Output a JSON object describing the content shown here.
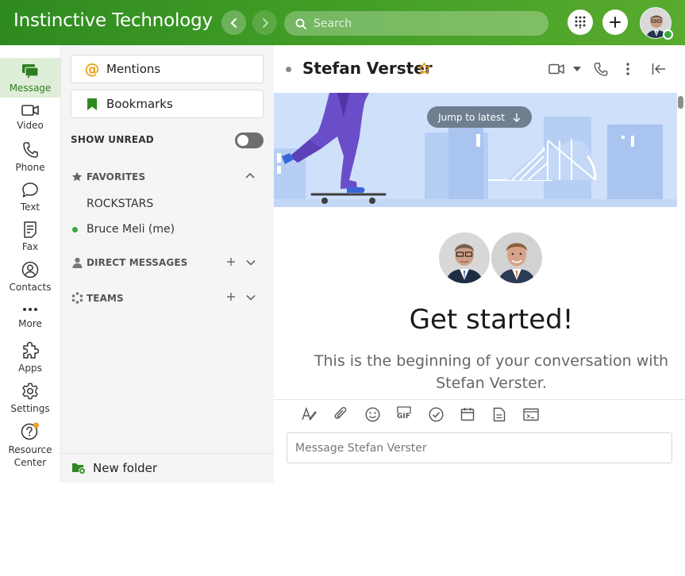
{
  "header": {
    "brand": "Instinctive Technology",
    "search_placeholder": "Search",
    "colors": {
      "bar_start": "#2e8a1f",
      "bar_end": "#58ab2e",
      "presence": "#3aa83a"
    }
  },
  "rail": {
    "items": [
      {
        "label": "Message",
        "icon": "message-icon",
        "active": true
      },
      {
        "label": "Video",
        "icon": "video-icon"
      },
      {
        "label": "Phone",
        "icon": "phone-icon"
      },
      {
        "label": "Text",
        "icon": "text-bubble-icon"
      },
      {
        "label": "Fax",
        "icon": "fax-icon"
      },
      {
        "label": "Contacts",
        "icon": "contacts-icon"
      },
      {
        "label": "More",
        "icon": "more-dots-icon"
      },
      {
        "label": "Apps",
        "icon": "puzzle-icon"
      },
      {
        "label": "Settings",
        "icon": "gear-icon"
      },
      {
        "label": "Resource Center",
        "icon": "help-icon"
      }
    ]
  },
  "sidebar": {
    "mentions": "Mentions",
    "bookmarks": "Bookmarks",
    "show_unread": "SHOW UNREAD",
    "favorites": {
      "title": "FAVORITES",
      "items": [
        "ROCKSTARS",
        "Bruce Meli (me)"
      ]
    },
    "direct_messages": "DIRECT MESSAGES",
    "teams": "TEAMS",
    "new_folder": "New folder"
  },
  "conversation": {
    "title": "Stefan Verster",
    "jump_to_latest": "Jump to latest",
    "heading": "Get started!",
    "intro": "This is the beginning of your conversation with Stefan Verster.",
    "composer_placeholder": "Message Stefan Verster",
    "toolbar_icons": [
      "format-icon",
      "attach-icon",
      "emoji-icon",
      "gif-icon",
      "task-icon",
      "calendar-icon",
      "note-icon",
      "code-icon"
    ],
    "gif_label": "GIF"
  }
}
